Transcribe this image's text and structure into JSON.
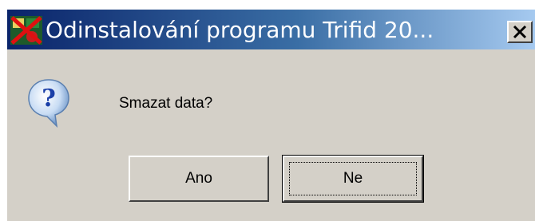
{
  "window": {
    "title": "Odinstalování programu Trifid 20...",
    "app_icon": "trifid-app-icon",
    "close_icon": "close-icon"
  },
  "message": {
    "icon": "question-icon",
    "text": "Smazat data?"
  },
  "buttons": {
    "yes_label": "Ano",
    "no_label": "Ne",
    "default": "no"
  },
  "colors": {
    "title_start": "#0a246a",
    "title_end": "#a6caf0",
    "dialog_bg": "#d4d0c8"
  }
}
